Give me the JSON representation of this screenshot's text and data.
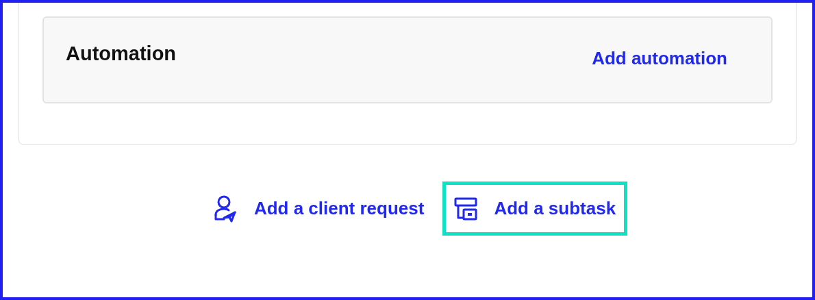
{
  "automation": {
    "title": "Automation",
    "action": "Add automation"
  },
  "actions": [
    {
      "kind": "client-request",
      "label": "Add a client request",
      "highlighted": false
    },
    {
      "kind": "subtask",
      "label": "Add a subtask",
      "highlighted": true
    }
  ]
}
